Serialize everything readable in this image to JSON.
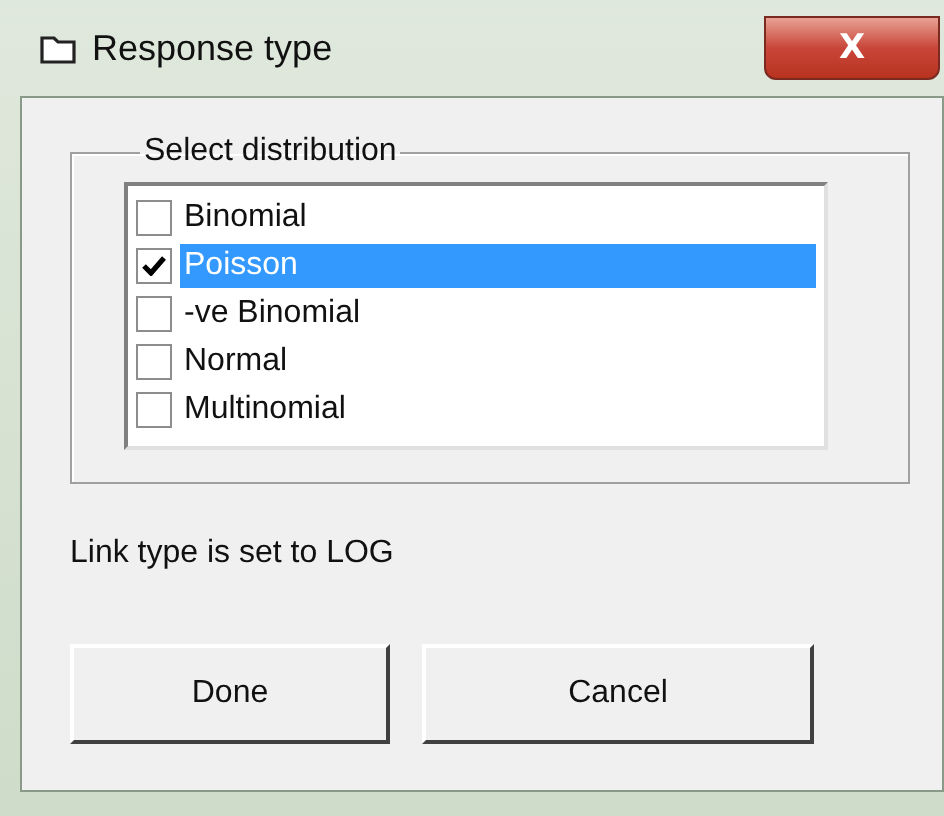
{
  "window": {
    "title": "Response type",
    "close": "X"
  },
  "group": {
    "label": "Select distribution",
    "items": [
      {
        "label": "Binomial",
        "checked": false,
        "selected": false
      },
      {
        "label": "Poisson",
        "checked": true,
        "selected": true
      },
      {
        "label": "-ve Binomial",
        "checked": false,
        "selected": false
      },
      {
        "label": "Normal",
        "checked": false,
        "selected": false
      },
      {
        "label": "Multinomial",
        "checked": false,
        "selected": false
      }
    ]
  },
  "status": "Link type is set to LOG",
  "buttons": [
    "Done",
    "Cancel"
  ]
}
